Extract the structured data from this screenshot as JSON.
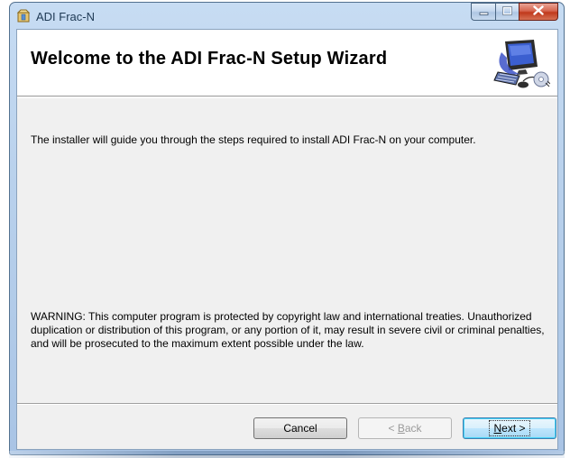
{
  "window": {
    "title": "ADI Frac-N",
    "icon": "installer-package-icon",
    "caption_buttons": [
      "minimize-icon",
      "maximize-icon",
      "close-icon"
    ]
  },
  "banner": {
    "title": "Welcome to the ADI Frac-N Setup Wizard",
    "art": "computer-setup-icon"
  },
  "body": {
    "intro": "The installer will guide you through the steps required to install ADI Frac-N on your computer.",
    "warning": "WARNING: This computer program is protected by copyright law and international treaties. Unauthorized duplication or distribution of this program, or any portion of it, may result in severe civil or criminal penalties, and will be prosecuted to the maximum extent possible under the law."
  },
  "buttons": {
    "cancel": "Cancel",
    "back_prefix": "< ",
    "back_accel": "B",
    "back_rest": "ack",
    "next_accel": "N",
    "next_rest": "ext >"
  },
  "colors": {
    "close_button": "#c0391c",
    "client_background": "#f0f0f0",
    "default_button_border": "#3c7fb1"
  }
}
